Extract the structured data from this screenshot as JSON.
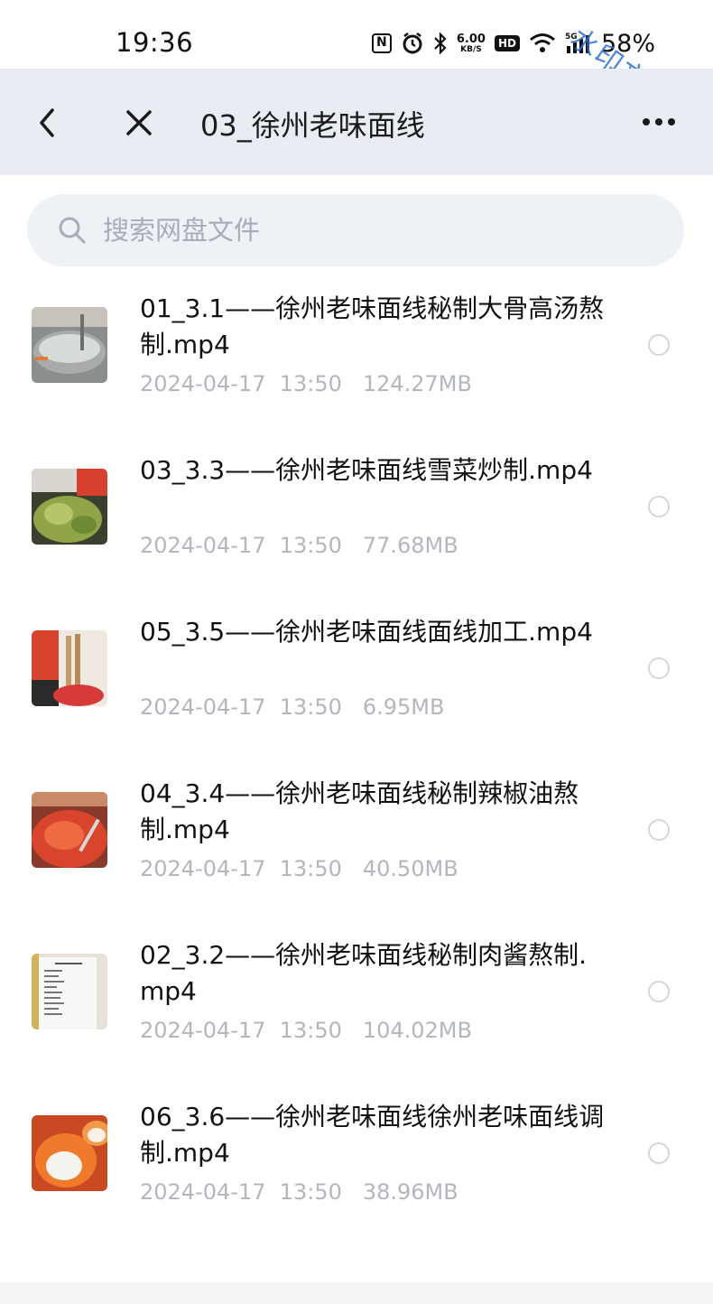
{
  "status_bar": {
    "time": "19:36",
    "speed_value": "6.00",
    "speed_unit": "KB/S",
    "hd": "HD",
    "network": "5G",
    "battery": "58%",
    "icons": [
      "nfc-icon",
      "alarm-icon",
      "bluetooth-icon",
      "wifi-icon",
      "signal-icon"
    ]
  },
  "watermark": "水印文字",
  "nav": {
    "title": "03_徐州老味面线"
  },
  "search": {
    "placeholder": "搜索网盘文件"
  },
  "files": [
    {
      "name": "01_3.1——徐州老味面线秘制大骨高汤熬制.mp4",
      "date": "2024-04-17",
      "time": "13:50",
      "size": "124.27MB"
    },
    {
      "name": "03_3.3——徐州老味面线雪菜炒制.mp4",
      "date": "2024-04-17",
      "time": "13:50",
      "size": "77.68MB"
    },
    {
      "name": "05_3.5——徐州老味面线面线加工.mp4",
      "date": "2024-04-17",
      "time": "13:50",
      "size": "6.95MB"
    },
    {
      "name": "04_3.4——徐州老味面线秘制辣椒油熬制.mp4",
      "date": "2024-04-17",
      "time": "13:50",
      "size": "40.50MB"
    },
    {
      "name": "02_3.2——徐州老味面线秘制肉酱熬制.mp4",
      "date": "2024-04-17",
      "time": "13:50",
      "size": "104.02MB"
    },
    {
      "name": "06_3.6——徐州老味面线徐州老味面线调制.mp4",
      "date": "2024-04-17",
      "time": "13:50",
      "size": "38.96MB"
    }
  ],
  "colors": {
    "nav_bg": "#e9edf3",
    "search_bg": "#eef2f7",
    "meta_text": "#b3b7bd",
    "watermark": "#2f6fd6"
  }
}
